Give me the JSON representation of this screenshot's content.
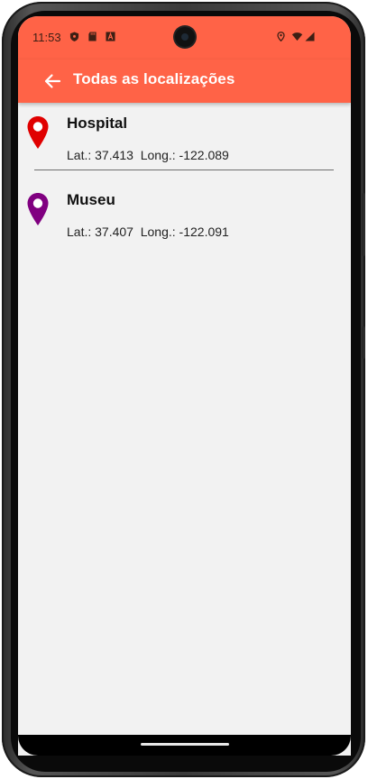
{
  "status_bar": {
    "time": "11:53",
    "left_icons": [
      "shield-icon",
      "sd-card-icon",
      "font-icon"
    ],
    "right_icons": [
      "location-icon",
      "wifi-icon",
      "signal-icon"
    ]
  },
  "app_bar": {
    "back_icon": "arrow-left-icon",
    "title": "Todas as localizações",
    "color": "#ff6347"
  },
  "locations": [
    {
      "name": "Hospital",
      "coords": "Lat.: 37.413  Long.: -122.089",
      "pin_color": "#e00000"
    },
    {
      "name": "Museu",
      "coords": "Lat.: 37.407  Long.: -122.091",
      "pin_color": "#800080"
    }
  ]
}
